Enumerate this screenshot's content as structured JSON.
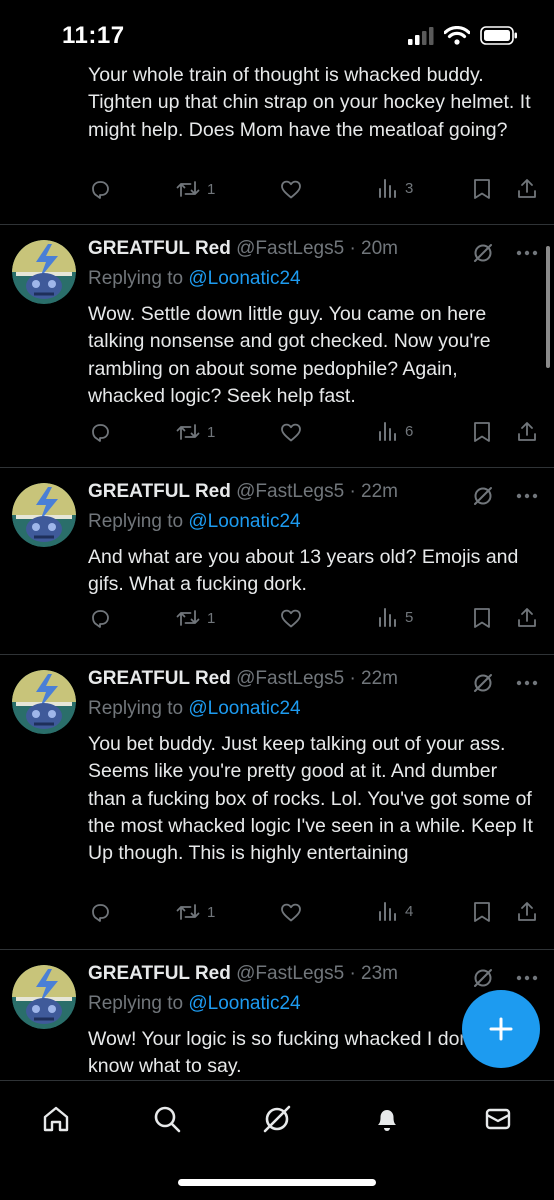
{
  "status_bar": {
    "time": "11:17"
  },
  "tweets": [
    {
      "text": "Your whole train of thought is whacked buddy. Tighten up that chin strap on your hockey helmet. It might help. Does Mom have the meatloaf going?",
      "retweets": "1",
      "views": "3"
    },
    {
      "name": "GREATFUL Red",
      "handle": "@FastLegs5",
      "time": "· 20m",
      "replying_prefix": "Replying to ",
      "replying_to": "@Loonatic24",
      "text": "Wow. Settle down little guy. You came on here talking nonsense and got checked. Now you're rambling on about some pedophile? Again, whacked logic? Seek help fast.",
      "retweets": "1",
      "views": "6"
    },
    {
      "name": "GREATFUL Red",
      "handle": "@FastLegs5",
      "time": "· 22m",
      "replying_prefix": "Replying to ",
      "replying_to": "@Loonatic24",
      "text": "And what are you about 13 years old? Emojis and gifs. What a fucking dork.",
      "retweets": "1",
      "views": "5"
    },
    {
      "name": "GREATFUL Red",
      "handle": "@FastLegs5",
      "time": "· 22m",
      "replying_prefix": "Replying to ",
      "replying_to": "@Loonatic24",
      "text": "You bet buddy. Just keep talking out of your ass. Seems like you're pretty good at it. And dumber than a fucking box of rocks. Lol. You've got some of the most whacked logic I've seen in a while. Keep It Up though. This is highly entertaining",
      "retweets": "1",
      "views": "4"
    },
    {
      "name": "GREATFUL Red",
      "handle": "@FastLegs5",
      "time": "· 23m",
      "replying_prefix": "Replying to ",
      "replying_to": "@Loonatic24",
      "text": "Wow! Your logic is so fucking whacked I don't even know what to say."
    }
  ],
  "icons": {
    "reply": "reply-icon",
    "retweet": "retweet-icon",
    "like": "heart-icon",
    "views": "views-icon",
    "bookmark": "bookmark-icon",
    "share": "share-icon",
    "grok": "grok-icon",
    "more": "more-icon",
    "compose": "compose-icon"
  },
  "bottom_nav": [
    "home-icon",
    "search-icon",
    "grok-icon",
    "notifications-icon",
    "messages-icon"
  ],
  "colors": {
    "background": "#000000",
    "accent": "#1d9bf0",
    "secondary_text": "#71767b",
    "divider": "#2f3336"
  }
}
